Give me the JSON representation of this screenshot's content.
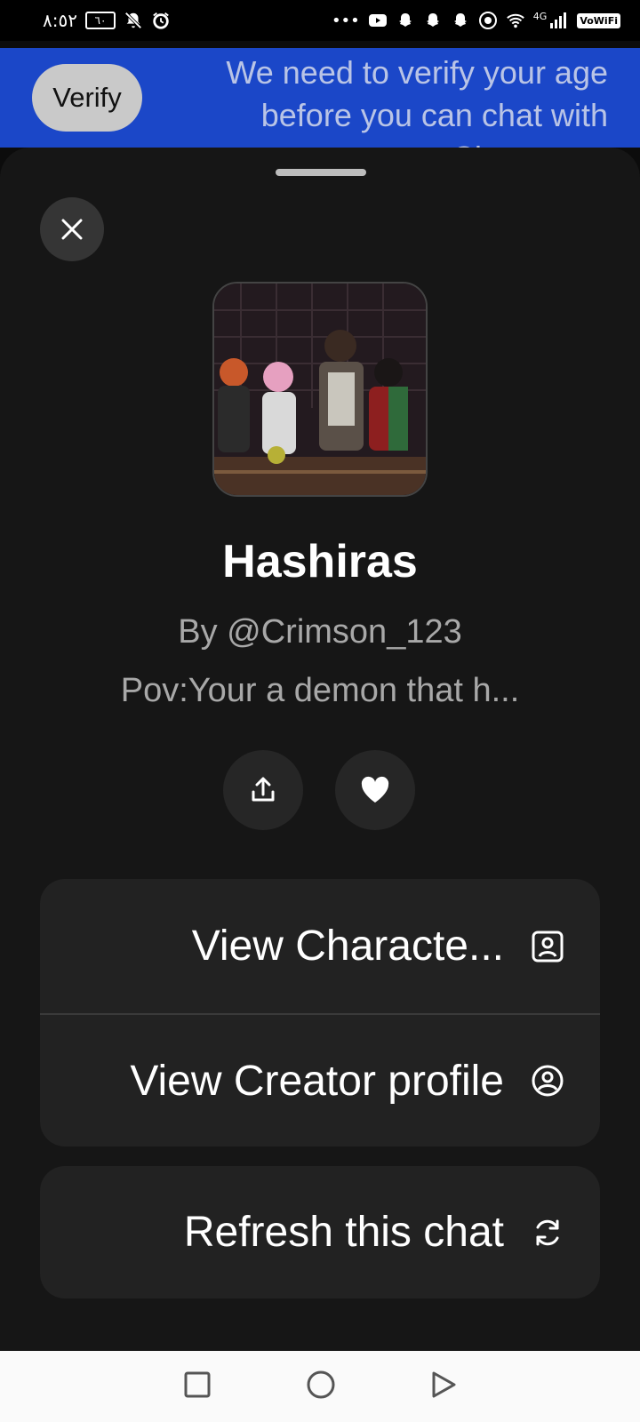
{
  "status_bar": {
    "time": "٨:٥٢",
    "battery": "٦٠",
    "network": "4G",
    "vowifi": "VoWiFi",
    "left_icons": [
      "battery-icon",
      "notifications-off-icon",
      "alarm-icon"
    ],
    "right_icons": [
      "more-dots-icon",
      "youtube-icon",
      "snapchat-icon",
      "snapchat-icon",
      "snapchat-icon",
      "screen-record-icon",
      "wifi-icon",
      "signal-icon"
    ]
  },
  "banner": {
    "verify_label": "Verify",
    "message": "We need to verify your age before you can chat with Characters"
  },
  "sheet": {
    "close_icon": "close-icon",
    "character_name": "Hashiras",
    "creator": "By @Crimson_123",
    "description": "Pov:Your a demon that h...",
    "share_icon": "share-icon",
    "like_icon": "heart-icon"
  },
  "menu": {
    "items": [
      {
        "label": "View Characte...",
        "icon": "character-card-icon"
      },
      {
        "label": "View Creator profile",
        "icon": "profile-circle-icon"
      }
    ],
    "refresh": {
      "label": "Refresh this chat",
      "icon": "refresh-icon"
    }
  },
  "nav_bar": {
    "icons": [
      "recents-square-icon",
      "home-circle-icon",
      "back-triangle-icon"
    ]
  },
  "colors": {
    "banner": "#1b47c8",
    "sheet": "#161616",
    "card": "#222222"
  }
}
